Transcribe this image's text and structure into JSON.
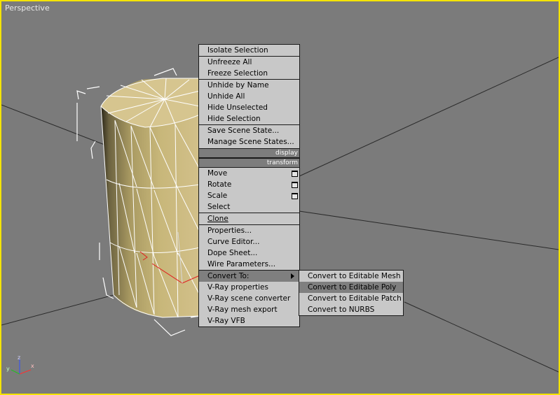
{
  "viewport": {
    "label": "Perspective"
  },
  "axes": {
    "x": "x",
    "y": "y",
    "z": "z"
  },
  "quad_menu": {
    "group1": [
      "Isolate Selection",
      "Unfreeze All",
      "Freeze Selection"
    ],
    "group2": [
      "Unhide by Name",
      "Unhide All",
      "Hide Unselected",
      "Hide Selection"
    ],
    "group3": [
      "Save Scene State...",
      "Manage Scene States..."
    ],
    "header_display": "display",
    "header_transform": "transform",
    "transform_items": [
      "Move",
      "Rotate",
      "Scale",
      "Select"
    ],
    "clone": "Clone",
    "group5": [
      "Properties...",
      "Curve Editor...",
      "Dope Sheet...",
      "Wire Parameters..."
    ],
    "group6": [
      "Convert To:",
      "V-Ray properties",
      "V-Ray scene converter",
      "V-Ray mesh export",
      "V-Ray VFB"
    ]
  },
  "submenu": {
    "items": [
      "Convert to Editable Mesh",
      "Convert to Editable Poly",
      "Convert to Editable Patch",
      "Convert to NURBS"
    ],
    "highlighted": "Convert to Editable Poly"
  },
  "colors": {
    "viewport_border": "#f5e400",
    "cylinder": "#c8b77a",
    "menu_bg": "#c8c8c8",
    "highlight": "#7f7f7f"
  }
}
